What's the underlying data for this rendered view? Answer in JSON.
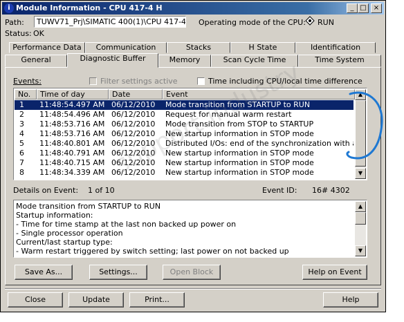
{
  "window": {
    "title": "Module Information - CPU 417-4 H",
    "buttons": {
      "minimize": "_",
      "maximize": "□",
      "close": "×"
    }
  },
  "header": {
    "path_label": "Path:",
    "path_value": "TUWV71_Prj\\SIMATIC 400(1)\\CPU 417-4 H",
    "op_mode_label": "Operating mode of the  CPU:",
    "op_mode_icon": "diamond-run-icon",
    "op_mode_value": "RUN",
    "status_label": "Status:",
    "status_value": "OK"
  },
  "tabs": {
    "row_top": [
      "Performance Data",
      "Communication",
      "Stacks",
      "H State",
      "Identification"
    ],
    "row_bottom": [
      "General",
      "Diagnostic Buffer",
      "Memory",
      "Scan Cycle Time",
      "Time System"
    ],
    "active": "Diagnostic Buffer"
  },
  "events": {
    "label": "Events:",
    "filter_label": "Filter settings active",
    "time_label": "Time including CPU/local time difference",
    "columns": [
      "No.",
      "Time of day",
      "Date",
      "Event"
    ],
    "rows": [
      {
        "no": "1",
        "time": "11:48:54.497 AM",
        "date": "06/12/2010",
        "event": "Mode transition from STARTUP to RUN"
      },
      {
        "no": "2",
        "time": "11:48:54.496 AM",
        "date": "06/12/2010",
        "event": "Request for manual warm restart"
      },
      {
        "no": "3",
        "time": "11:48:53.716 AM",
        "date": "06/12/2010",
        "event": "Mode transition from STOP to STARTUP"
      },
      {
        "no": "4",
        "time": "11:48:53.716 AM",
        "date": "06/12/2010",
        "event": "New startup information in STOP mode"
      },
      {
        "no": "5",
        "time": "11:48:40.801 AM",
        "date": "06/12/2010",
        "event": "Distributed I/Os: end of the synchronization with a D..."
      },
      {
        "no": "6",
        "time": "11:48:40.791 AM",
        "date": "06/12/2010",
        "event": "New startup information in STOP mode"
      },
      {
        "no": "7",
        "time": "11:48:40.715 AM",
        "date": "06/12/2010",
        "event": "New startup information in STOP mode"
      },
      {
        "no": "8",
        "time": "11:48:34.339 AM",
        "date": "06/12/2010",
        "event": "New startup information in STOP mode"
      }
    ]
  },
  "details": {
    "label": "Details on Event:",
    "counter": "1 of 10",
    "event_id_label": "Event ID:",
    "event_id_value": "16# 4302",
    "lines": [
      "Mode transition from STARTUP to RUN",
      "Startup information:",
      "- Time for time stamp at the last non backed up power on",
      "- Single processor operation",
      "Current/last startup type:",
      "- Warm restart triggered by switch setting; last power on not backed up"
    ]
  },
  "actions": {
    "save_as": "Save As...",
    "settings": "Settings...",
    "open_block": "Open Block",
    "help_on_event": "Help on Event"
  },
  "footer": {
    "close": "Close",
    "update": "Update",
    "print": "Print...",
    "help": "Help"
  },
  "watermark": "support.industry",
  "colors": {
    "selection": "#0a246a",
    "annotation": "#1e78d2"
  }
}
